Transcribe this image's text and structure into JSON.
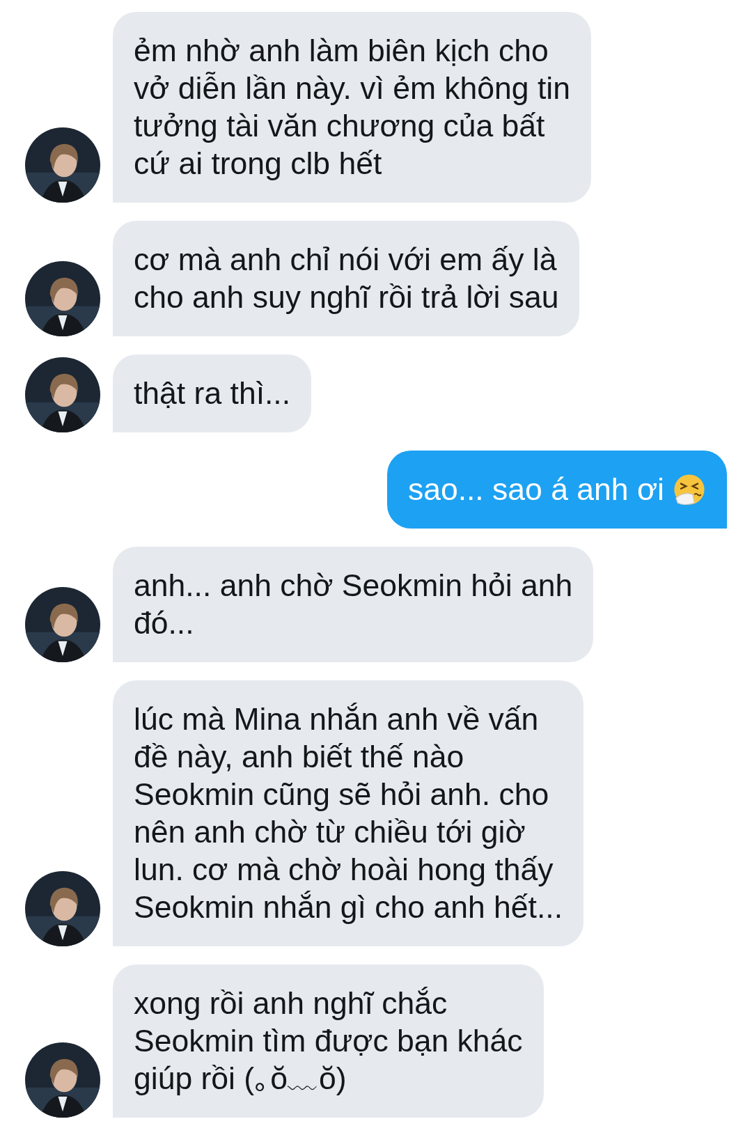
{
  "messages": [
    {
      "kind": "received",
      "avatar": true,
      "lines": [
        "ẻm nhờ anh làm biên kịch cho",
        "vở diễn lần này. vì ẻm không tin",
        "tưởng tài văn chương của bất",
        "cứ ai trong clb hết"
      ]
    },
    {
      "kind": "received",
      "avatar": true,
      "lines": [
        "cơ mà anh chỉ nói với em ấy là",
        "cho anh suy nghĩ rồi trả lời sau"
      ]
    },
    {
      "kind": "received",
      "avatar": true,
      "lines": [
        "thật ra thì..."
      ]
    },
    {
      "kind": "sent",
      "emoji": true,
      "lines": [
        "sao... sao á anh ơi"
      ]
    },
    {
      "kind": "received",
      "avatar": true,
      "lines": [
        "anh... anh chờ Seokmin hỏi anh",
        "đó..."
      ]
    },
    {
      "kind": "received",
      "avatar": true,
      "lines": [
        "lúc mà Mina nhắn anh về vấn",
        "đề này, anh biết thế nào",
        "Seokmin cũng sẽ hỏi anh. cho",
        "nên anh chờ từ chiều tới giờ",
        "lun. cơ mà chờ hoài hong thấy",
        "Seokmin nhắn gì cho anh hết..."
      ]
    },
    {
      "kind": "received",
      "avatar": true,
      "lines": [
        "xong rồi anh nghĩ chắc",
        "Seokmin tìm được bạn khác",
        "giúp rồi (｡ŏ﹏ŏ)"
      ]
    }
  ]
}
